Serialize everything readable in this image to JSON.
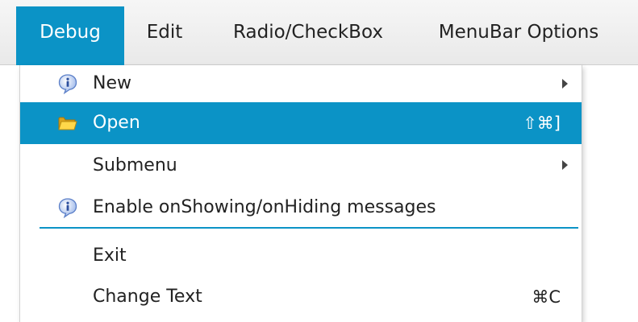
{
  "menubar": {
    "items": [
      {
        "label": "Debug"
      },
      {
        "label": "Edit"
      },
      {
        "label": "Radio/CheckBox"
      },
      {
        "label": "MenuBar Options"
      }
    ]
  },
  "dropdown": {
    "items": [
      {
        "label": "New",
        "icon": "info-icon",
        "submenu": true
      },
      {
        "label": "Open",
        "icon": "folder-icon",
        "shortcut": "⇧⌘]"
      },
      {
        "label": "Submenu",
        "submenu": true
      },
      {
        "label": "Enable onShowing/onHiding messages",
        "icon": "info-icon"
      },
      {
        "label": "Exit"
      },
      {
        "label": "Change Text",
        "shortcut": "⌘C"
      }
    ]
  },
  "colors": {
    "accent": "#0b93c6",
    "menubar_bg": "#efefef",
    "text": "#222222"
  }
}
